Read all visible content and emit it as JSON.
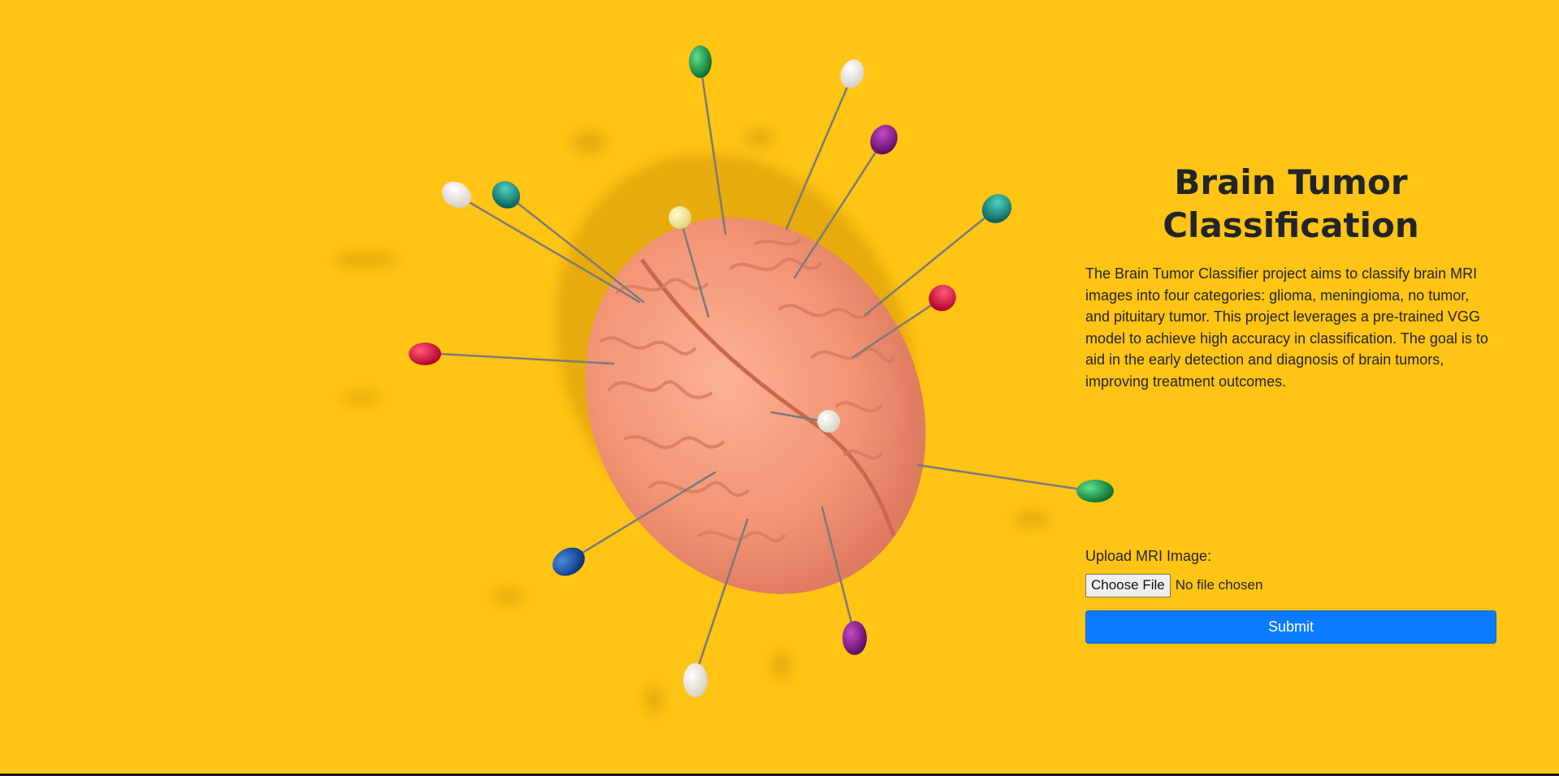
{
  "page": {
    "title": "Brain Tumor Classification",
    "description": "The Brain Tumor Classifier project aims to classify brain MRI images into four categories: glioma, meningioma, no tumor, and pituitary tumor. This project leverages a pre-trained VGG model to achieve high accuracy in classification. The goal is to aid in the early detection and diagnosis of brain tumors, improving treatment outcomes."
  },
  "form": {
    "upload_label": "Upload MRI Image:",
    "file_button_label": "Choose File",
    "file_status": "No file chosen",
    "submit_label": "Submit"
  },
  "colors": {
    "background": "#ffc414",
    "brain": "#f5977a",
    "submit_button": "#0a7bff",
    "text": "#212529"
  },
  "icons": {
    "hero_image": "brain-with-pins-image"
  }
}
